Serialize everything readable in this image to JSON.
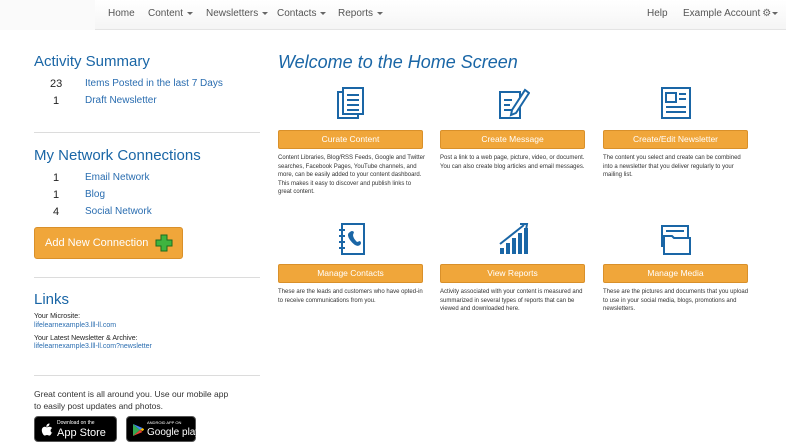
{
  "nav": {
    "home": "Home",
    "content": "Content",
    "newsletters": "Newsletters",
    "contacts": "Contacts",
    "reports": "Reports",
    "help": "Help",
    "account": "Example Account"
  },
  "activity": {
    "title": "Activity Summary",
    "items": [
      {
        "count": "23",
        "label": "Items Posted in the last 7 Days"
      },
      {
        "count": "1",
        "label": "Draft Newsletter"
      }
    ]
  },
  "network": {
    "title": "My Network Connections",
    "items": [
      {
        "count": "1",
        "label": "Email Network"
      },
      {
        "count": "1",
        "label": "Blog"
      },
      {
        "count": "4",
        "label": "Social Network"
      }
    ],
    "add_button": "Add New Connection"
  },
  "links": {
    "title": "Links",
    "microsite_label": "Your Microsite:",
    "microsite_url": "lifelearnexample3.lll-ll.com",
    "newsletter_label": "Your Latest Newsletter & Archive:",
    "newsletter_url": "lifelearnexample3.lll-ll.com?newsletter"
  },
  "promo": {
    "text": "Great content is all around you. Use our mobile app to easily post updates and photos.",
    "appstore_small": "Download on the",
    "appstore_big": "App Store",
    "googleplay_small": "ANDROID APP ON",
    "googleplay_big": "Google play"
  },
  "main": {
    "welcome": "Welcome to the Home Screen",
    "features": [
      {
        "icon": "documents-icon",
        "button": "Curate Content",
        "desc": "Content Libraries, Blog/RSS Feeds, Google and Twitter searches, Facebook Pages, YouTube channels, and more, can be easily added to your content dashboard. This makes it easy to discover and publish links to great content."
      },
      {
        "icon": "pen-paper-icon",
        "button": "Create Message",
        "desc": "Post a link to a web page, picture, video, or document. You can also create blog articles and email messages."
      },
      {
        "icon": "newsletter-icon",
        "button": "Create/Edit Newsletter",
        "desc": "The content you select and create can be combined into a newsletter that you deliver regularly to your mailing list."
      },
      {
        "icon": "address-book-icon",
        "button": "Manage Contacts",
        "desc": "These are the leads and customers who have opted-in to receive communications from you."
      },
      {
        "icon": "bar-chart-icon",
        "button": "View Reports",
        "desc": "Activity associated with your content is measured and summarized in several types of reports that can be viewed and downloaded here."
      },
      {
        "icon": "folder-icon",
        "button": "Manage Media",
        "desc": "These are the pictures and documents that you upload to use in your social media, blogs, promotions and newsletters."
      }
    ]
  },
  "colors": {
    "accent": "#f0a63a",
    "link": "#2a6db0",
    "heading": "#1a66a6"
  }
}
